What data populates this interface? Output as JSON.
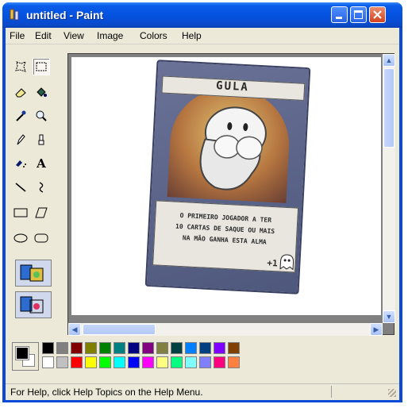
{
  "window": {
    "title": "untitled - Paint",
    "minimize_glyph": "_",
    "maximize_glyph": "□",
    "close_glyph": "✕"
  },
  "menu": [
    "File",
    "Edit",
    "View",
    "Image",
    "Colors",
    "Help"
  ],
  "tools": [
    {
      "name": "free-form-select-icon",
      "glyph": "☆"
    },
    {
      "name": "select-icon",
      "glyph": "⬚"
    },
    {
      "name": "eraser-icon",
      "glyph": "◧"
    },
    {
      "name": "fill-icon",
      "glyph": "⬙"
    },
    {
      "name": "pick-color-icon",
      "glyph": "✎"
    },
    {
      "name": "magnifier-icon",
      "glyph": "🔍"
    },
    {
      "name": "pencil-icon",
      "glyph": "✏"
    },
    {
      "name": "brush-icon",
      "glyph": "🖌"
    },
    {
      "name": "airbrush-icon",
      "glyph": "✈"
    },
    {
      "name": "text-icon",
      "glyph": "A"
    },
    {
      "name": "line-icon",
      "glyph": "╲"
    },
    {
      "name": "curve-icon",
      "glyph": "∫"
    },
    {
      "name": "rectangle-icon",
      "glyph": "▭"
    },
    {
      "name": "polygon-icon",
      "glyph": "⏢"
    },
    {
      "name": "ellipse-icon",
      "glyph": "⬭"
    },
    {
      "name": "rounded-rectangle-icon",
      "glyph": "▢"
    }
  ],
  "card": {
    "title": "GULA",
    "text_lines": [
      "O PRIMEIRO JOGADOR A TER",
      "10 CARTAS DE SAQUE OU MAIS",
      "NA MÃO GANHA ESTA ALMA"
    ],
    "points": "+1"
  },
  "palette": {
    "foreground": "#000000",
    "background": "#ffffff",
    "row1": [
      "#000000",
      "#808080",
      "#800000",
      "#808000",
      "#008000",
      "#008080",
      "#000080",
      "#800080",
      "#808040",
      "#004040",
      "#0080ff",
      "#004080",
      "#8000ff",
      "#804000"
    ],
    "row2": [
      "#ffffff",
      "#c0c0c0",
      "#ff0000",
      "#ffff00",
      "#00ff00",
      "#00ffff",
      "#0000ff",
      "#ff00ff",
      "#ffff80",
      "#00ff80",
      "#80ffff",
      "#8080ff",
      "#ff0080",
      "#ff8040"
    ]
  },
  "status": {
    "text": "For Help, click Help Topics on the Help Menu."
  },
  "colors": {
    "title_bar": "#0551e0",
    "chrome": "#ece9d8",
    "card_bg": "#58628a"
  }
}
